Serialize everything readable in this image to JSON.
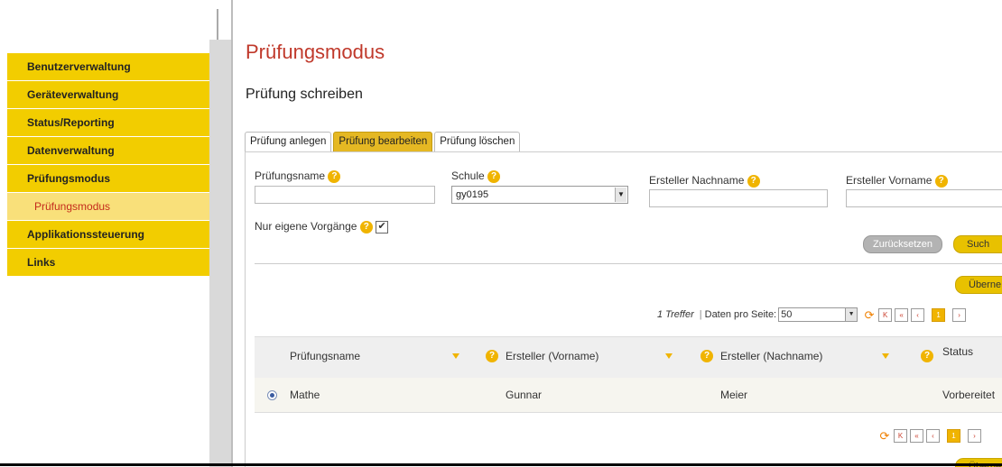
{
  "sidebar": {
    "items": [
      {
        "label": "Benutzerverwaltung"
      },
      {
        "label": "Geräteverwaltung"
      },
      {
        "label": "Status/Reporting"
      },
      {
        "label": "Datenverwaltung"
      },
      {
        "label": "Prüfungsmodus"
      }
    ],
    "sub_item": {
      "label": "Prüfungsmodus"
    },
    "items_after": [
      {
        "label": "Applikationssteuerung"
      },
      {
        "label": "Links"
      }
    ]
  },
  "page": {
    "title": "Prüfungsmodus",
    "section_title": "Prüfung schreiben"
  },
  "tabs": [
    {
      "label": "Prüfung anlegen"
    },
    {
      "label": "Prüfung bearbeiten"
    },
    {
      "label": "Prüfung löschen"
    }
  ],
  "filters": {
    "exam_name_label": "Prüfungsname",
    "exam_name_value": "",
    "school_label": "Schule",
    "school_value": "gy0195",
    "creator_last_label": "Ersteller Nachname",
    "creator_last_value": "",
    "creator_first_label": "Ersteller Vorname",
    "creator_first_value": "",
    "own_only_label": "Nur eigene Vorgänge",
    "own_only_checked": true,
    "help_glyph": "?",
    "check_glyph": "✔"
  },
  "buttons": {
    "reset": "Zurücksetzen",
    "search": "Such",
    "apply_top": "Überne",
    "apply_bottom": "Überne"
  },
  "pager": {
    "hits": "1 Treffer",
    "per_page_label": "Daten pro Seite:",
    "per_page_value": "50",
    "current_page": "1",
    "refresh_glyph": "⟳",
    "first_glyph": "K",
    "prev_fast_glyph": "«",
    "prev_glyph": "‹",
    "next_glyph": "›"
  },
  "table": {
    "headers": [
      "Prüfungsname",
      "Ersteller (Vorname)",
      "Ersteller (Nachname)",
      "Status"
    ],
    "rows": [
      {
        "name": "Mathe",
        "first": "Gunnar",
        "last": "Meier",
        "status": "Vorbereitet",
        "selected": true
      }
    ]
  },
  "colors": {
    "accent": "#f2cd00",
    "title_red": "#c0392b",
    "active_tab": "#e5b823"
  },
  "icons": [
    "help-icon",
    "checkbox-icon",
    "refresh-icon",
    "first-page-icon",
    "prev-fast-icon",
    "prev-page-icon",
    "next-page-icon",
    "sort-icon",
    "radio-icon",
    "dropdown-arrow-icon"
  ]
}
